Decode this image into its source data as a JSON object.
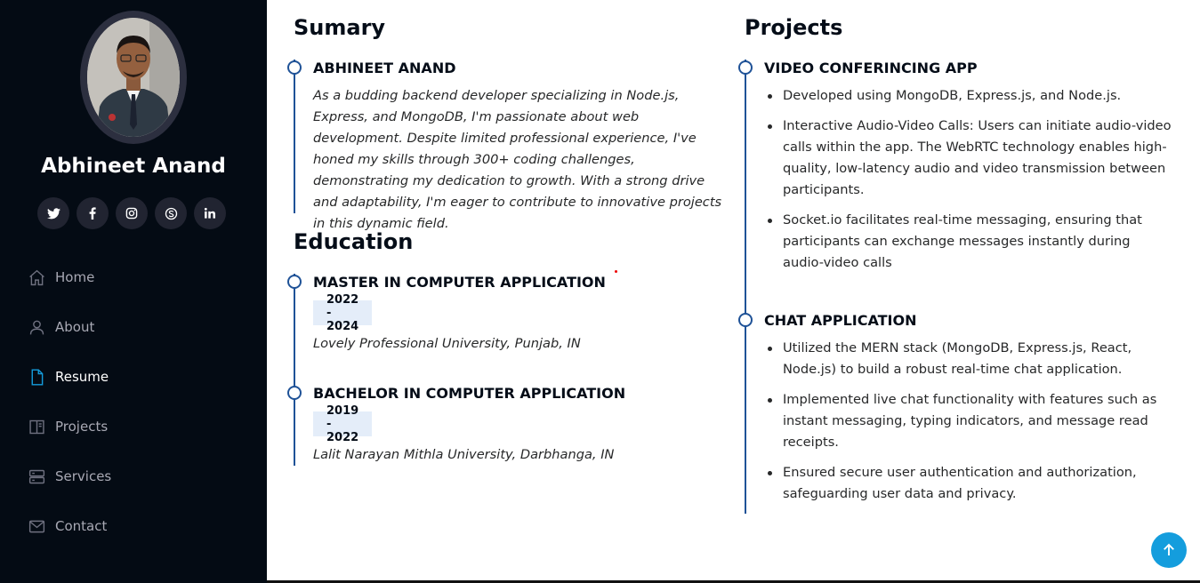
{
  "sidebar": {
    "name": "Abhineet Anand",
    "socials": [
      {
        "icon": "twitter-icon",
        "glyph": "t"
      },
      {
        "icon": "facebook-icon",
        "glyph": "f"
      },
      {
        "icon": "instagram-icon",
        "glyph": "◎"
      },
      {
        "icon": "skype-icon",
        "glyph": "S"
      },
      {
        "icon": "linkedin-icon",
        "glyph": "in"
      }
    ],
    "nav": [
      {
        "label": "Home",
        "icon": "home-icon"
      },
      {
        "label": "About",
        "icon": "person-icon"
      },
      {
        "label": "Resume",
        "icon": "file-icon",
        "active": true
      },
      {
        "label": "Projects",
        "icon": "book-icon"
      },
      {
        "label": "Services",
        "icon": "server-icon"
      },
      {
        "label": "Contact",
        "icon": "envelope-icon"
      }
    ]
  },
  "summary": {
    "heading": "Sumary",
    "name": "ABHINEET ANAND",
    "text": "As a budding backend developer specializing in Node.js, Express, and MongoDB, I'm passionate about web development. Despite limited professional experience, I've honed my skills through 300+ coding challenges, demonstrating my dedication to growth. With a strong drive and adaptability, I'm eager to contribute to innovative projects in this dynamic field."
  },
  "education": {
    "heading": "Education",
    "items": [
      {
        "title": "MASTER IN COMPUTER APPLICATION",
        "years": "2022 - 2024",
        "school": "Lovely Professional University, Punjab, IN"
      },
      {
        "title": "BACHELOR IN COMPUTER APPLICATION",
        "years": "2019 - 2022",
        "school": "Lalit Narayan Mithla University, Darbhanga, IN"
      }
    ]
  },
  "projects": {
    "heading": "Projects",
    "items": [
      {
        "title": "VIDEO CONFERINCING APP",
        "bullets": [
          "Developed using MongoDB, Express.js, and Node.js.",
          "Interactive Audio-Video Calls: Users can initiate audio-video calls within the app. The WebRTC technology enables high-quality, low-latency audio and video transmission between participants.",
          "Socket.io facilitates real-time messaging, ensuring that participants can exchange messages instantly during audio-video calls"
        ]
      },
      {
        "title": "CHAT APPLICATION",
        "bullets": [
          "Utilized the MERN stack (MongoDB, Express.js, React, Node.js) to build a robust real-time chat application.",
          "Implemented live chat functionality with features such as instant messaging, typing indicators, and message read receipts.",
          "Ensured secure user authentication and authorization, safeguarding user data and privacy."
        ]
      }
    ]
  },
  "colors": {
    "sidebar_bg": "#040b14",
    "accent": "#149ddd",
    "timeline": "#1f5297"
  }
}
